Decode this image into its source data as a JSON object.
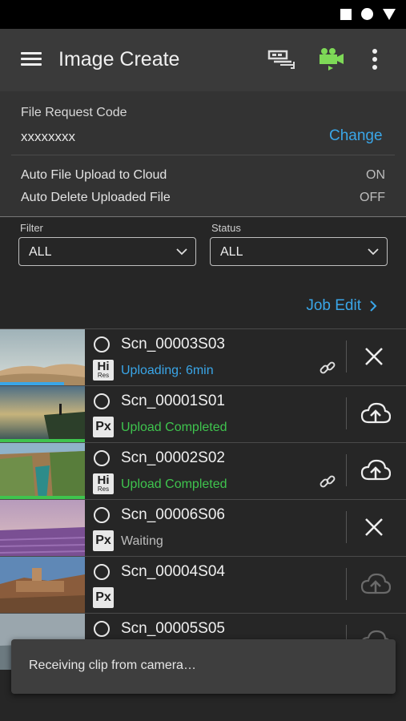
{
  "app": {
    "title": "Image Create"
  },
  "request": {
    "label": "File Request Code",
    "code": "xxxxxxxx",
    "change_label": "Change"
  },
  "settings": [
    {
      "label": "Auto File Upload to Cloud",
      "value": "ON"
    },
    {
      "label": "Auto Delete Uploaded File",
      "value": "OFF"
    }
  ],
  "filter": {
    "label": "Filter",
    "value": "ALL"
  },
  "status_filter": {
    "label": "Status",
    "value": "ALL"
  },
  "job_edit_label": "Job Edit",
  "clips": [
    {
      "name": "Scn_00003S03",
      "badge": "Hi",
      "badge_sub": "Res",
      "status": "Uploading:  6min",
      "status_color": "#3aa6e8",
      "progress": 0.75,
      "linked": true,
      "action": "cancel"
    },
    {
      "name": "Scn_00001S01",
      "badge": "Px",
      "status": "Upload Completed",
      "status_color": "#3fc44e",
      "progress": 1.0,
      "linked": false,
      "action": "upload"
    },
    {
      "name": "Scn_00002S02",
      "badge": "Hi",
      "badge_sub": "Res",
      "status": "Upload Completed",
      "status_color": "#3fc44e",
      "progress": 1.0,
      "linked": true,
      "action": "upload"
    },
    {
      "name": "Scn_00006S06",
      "badge": "Px",
      "status": "Waiting",
      "status_color": "#bdbdbd",
      "linked": false,
      "action": "cancel"
    },
    {
      "name": "Scn_00004S04",
      "badge": "Px",
      "status": "",
      "linked": false,
      "action": "upload-disabled"
    },
    {
      "name": "Scn_00005S05",
      "badge": "",
      "status": "",
      "linked": false,
      "action": "upload-disabled"
    }
  ],
  "toast": {
    "message": "Receiving clip from camera…"
  },
  "icons": [
    "menu-icon",
    "usb-streaming-icon",
    "camera-icon",
    "overflow-icon",
    "link-icon",
    "close-icon",
    "cloud-upload-icon",
    "chevron-down-icon",
    "chevron-right-icon"
  ],
  "colors": {
    "accent": "#3aa6e8",
    "success": "#3fc44e",
    "camera_icon": "#7ed957"
  }
}
